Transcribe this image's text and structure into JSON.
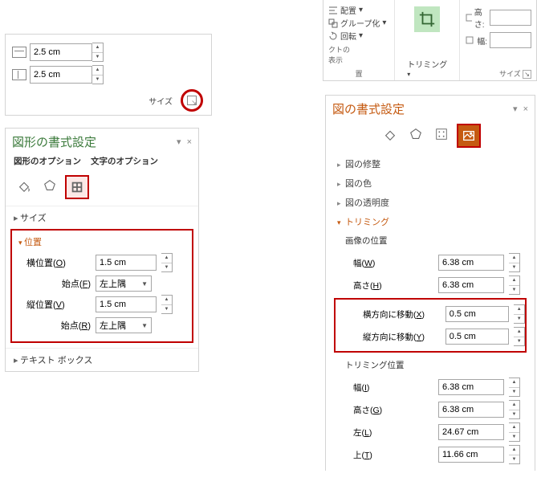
{
  "left": {
    "height_value": "2.5 cm",
    "width_value": "2.5 cm",
    "size_label": "サイズ",
    "pane_title": "図形の書式設定",
    "tab_shape": "図形のオプション",
    "tab_text": "文字のオプション",
    "section_size": "サイズ",
    "section_position": "位置",
    "hpos_label": "横位置(",
    "hpos_key": "O",
    "hpos_value": "1.5 cm",
    "origin_label_1": "始点(",
    "origin_key_1": "F",
    "origin_value_1": "左上隅",
    "vpos_label": "縦位置(",
    "vpos_key": "V",
    "vpos_value": "1.5 cm",
    "origin_label_2": "始点(",
    "origin_key_2": "R",
    "origin_value_2": "左上隅",
    "section_textbox": "テキスト ボックス"
  },
  "ribbon": {
    "align": "配置",
    "group": "グループ化",
    "rotate": "回転",
    "objects_prefix": "クトの",
    "show": "表示",
    "arrange_label": "置",
    "crop_label": "トリミング",
    "height_icon": "高さ:",
    "width_icon": "幅:",
    "size_label": "サイズ"
  },
  "right": {
    "pane_title": "図の書式設定",
    "sect_correction": "図の修整",
    "sect_color": "図の色",
    "sect_transparency": "図の透明度",
    "sect_crop": "トリミング",
    "img_pos_label": "画像の位置",
    "width_label": "幅(",
    "width_key": "W",
    "width_value": "6.38 cm",
    "height_label": "高さ(",
    "height_key": "H",
    "height_value": "6.38 cm",
    "offx_label": "横方向に移動(",
    "offx_key": "X",
    "offx_value": "0.5 cm",
    "offy_label": "縦方向に移動(",
    "offy_key": "Y",
    "offy_value": "0.5 cm",
    "crop_pos_label": "トリミング位置",
    "cw_label": "幅(",
    "cw_key": "I",
    "cw_value": "6.38 cm",
    "ch_label": "高さ(",
    "ch_key": "G",
    "ch_value": "6.38 cm",
    "cl_label": "左(",
    "cl_key": "L",
    "cl_value": "24.67 cm",
    "ct_label": "上(",
    "ct_key": "T",
    "ct_value": "11.66 cm"
  }
}
